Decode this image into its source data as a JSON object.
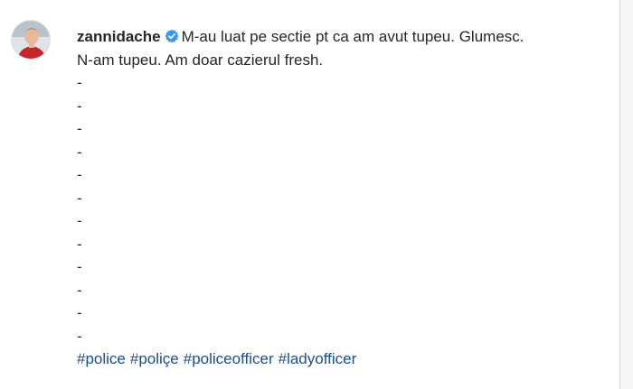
{
  "post": {
    "username": "zannidache",
    "verified_icon": "verified-badge-icon",
    "caption_first": "M-au luat pe sectie pt ca am avut tupeu. Glumesc.",
    "caption_second": "N-am tupeu. Am doar cazierul fresh.",
    "dashes": [
      "-",
      "-",
      "-",
      "-",
      "-",
      "-",
      "-",
      "-",
      "-",
      "-",
      "-",
      "-"
    ],
    "hashtags": [
      "#police",
      "#poliçe",
      "#policeofficer",
      "#ladyofficer"
    ]
  },
  "colors": {
    "text": "#262626",
    "hashtag": "#1c4d8a",
    "verified": "#3897f0"
  }
}
